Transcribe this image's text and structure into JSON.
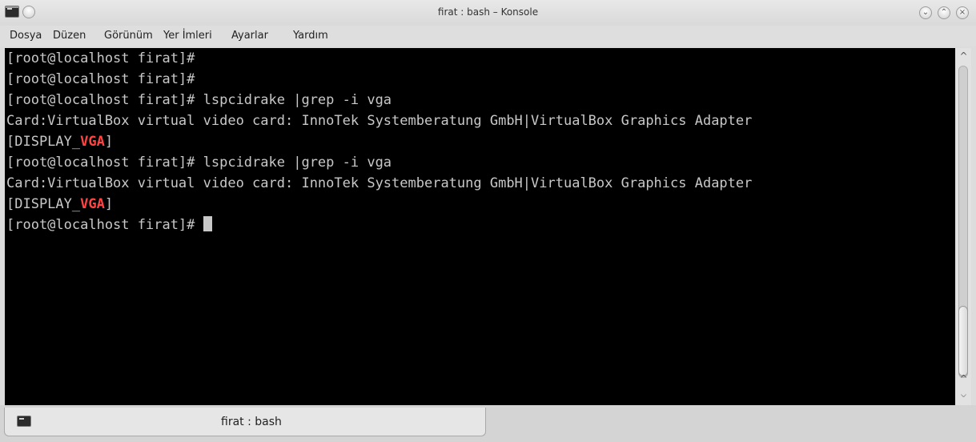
{
  "window": {
    "title": "firat : bash – Konsole",
    "buttons": {
      "minimize": "⌄",
      "maximize": "⌃",
      "close": "×"
    }
  },
  "menubar": {
    "items": [
      "Dosya",
      "Düzen",
      "Görünüm",
      "Yer İmleri",
      "Ayarlar",
      "Yardım"
    ]
  },
  "terminal": {
    "lines": [
      {
        "text": "[root@localhost firat]#"
      },
      {
        "text": "[root@localhost firat]#"
      },
      {
        "text": "[root@localhost firat]# lspcidrake |grep -i vga"
      },
      {
        "text": "Card:VirtualBox virtual video card: InnoTek Systemberatung GmbH|VirtualBox Graphics Adapter"
      },
      {
        "pre": "[DISPLAY_",
        "highlight": "VGA",
        "post": "]"
      },
      {
        "text": "[root@localhost firat]# lspcidrake |grep -i vga"
      },
      {
        "text": "Card:VirtualBox virtual video card: InnoTek Systemberatung GmbH|VirtualBox Graphics Adapter"
      },
      {
        "pre": "[DISPLAY_",
        "highlight": "VGA",
        "post": "]"
      },
      {
        "text": "[root@localhost firat]# "
      }
    ],
    "colors": {
      "background": "#000000",
      "foreground": "#c8c8c8",
      "highlight": "#ff4444"
    }
  },
  "scrollbar": {
    "up_arrow": "^",
    "down_arrow": "^",
    "position": 1.0
  },
  "tabs": [
    {
      "label": "firat : bash",
      "icon": "terminal-icon"
    }
  ]
}
